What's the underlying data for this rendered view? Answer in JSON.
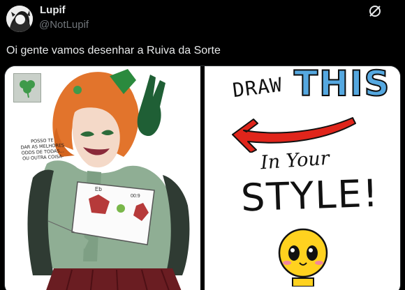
{
  "tweet": {
    "author": {
      "display_name": "Lupif",
      "handle": "@NotLupif",
      "avatar": "avatar-icon"
    },
    "more_icon": "more-icon",
    "text": "Oi gente vamos desenhar a Ruiva da Sorte",
    "media": {
      "left_panel": {
        "speech_lines": [
          "POSSO TE",
          "DAR AS MELHORES",
          "ODDS DE TODAS...",
          "OU OUTRA COISA-"
        ],
        "card_label_a": "Eb",
        "card_label_b": "00:9",
        "badge_icon": "clover-icon"
      },
      "right_panel": {
        "word_draw": "DRAW",
        "word_this": "THIS",
        "word_in_your": "In Your",
        "word_style": "STYLE!",
        "arrow_color": "#e0251b",
        "this_color": "#55a8e0",
        "mascot_color": "#ffd21f"
      }
    }
  }
}
